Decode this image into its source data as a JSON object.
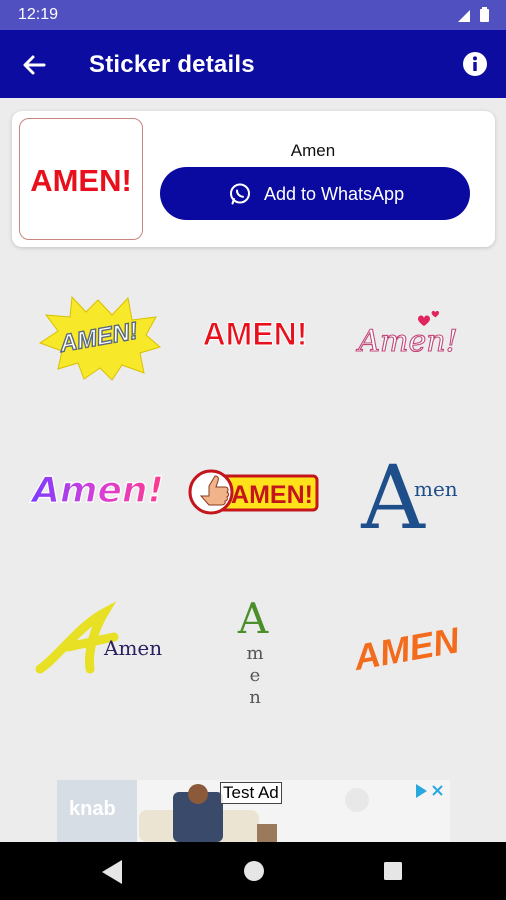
{
  "status_bar": {
    "time": "12:19"
  },
  "app_bar": {
    "title": "Sticker details"
  },
  "pack": {
    "name": "Amen",
    "tray_text": "AMEN!",
    "add_button_label": "Add to WhatsApp"
  },
  "stickers": [
    {
      "text": "AMEN!",
      "icon": "comic-burst-amen"
    },
    {
      "text": "AMEN!",
      "icon": "red-bold-amen"
    },
    {
      "text": "Amen!",
      "icon": "script-hearts-amen"
    },
    {
      "text": "Amen!",
      "icon": "gradient-script-amen"
    },
    {
      "text": "AMEN!",
      "icon": "thumbs-up-amen"
    },
    {
      "text": "Amen",
      "icon": "serif-blue-amen"
    },
    {
      "text": "Amen",
      "icon": "yellow-script-amen"
    },
    {
      "text": "Amen",
      "icon": "vertical-green-amen"
    },
    {
      "text": "AMEN",
      "icon": "orange-brush-amen"
    }
  ],
  "ad": {
    "label": "Test Ad",
    "brand": "knab"
  },
  "colors": {
    "primary": "#0d0ca0",
    "status": "#5050c0",
    "accent_red": "#e8101c"
  }
}
